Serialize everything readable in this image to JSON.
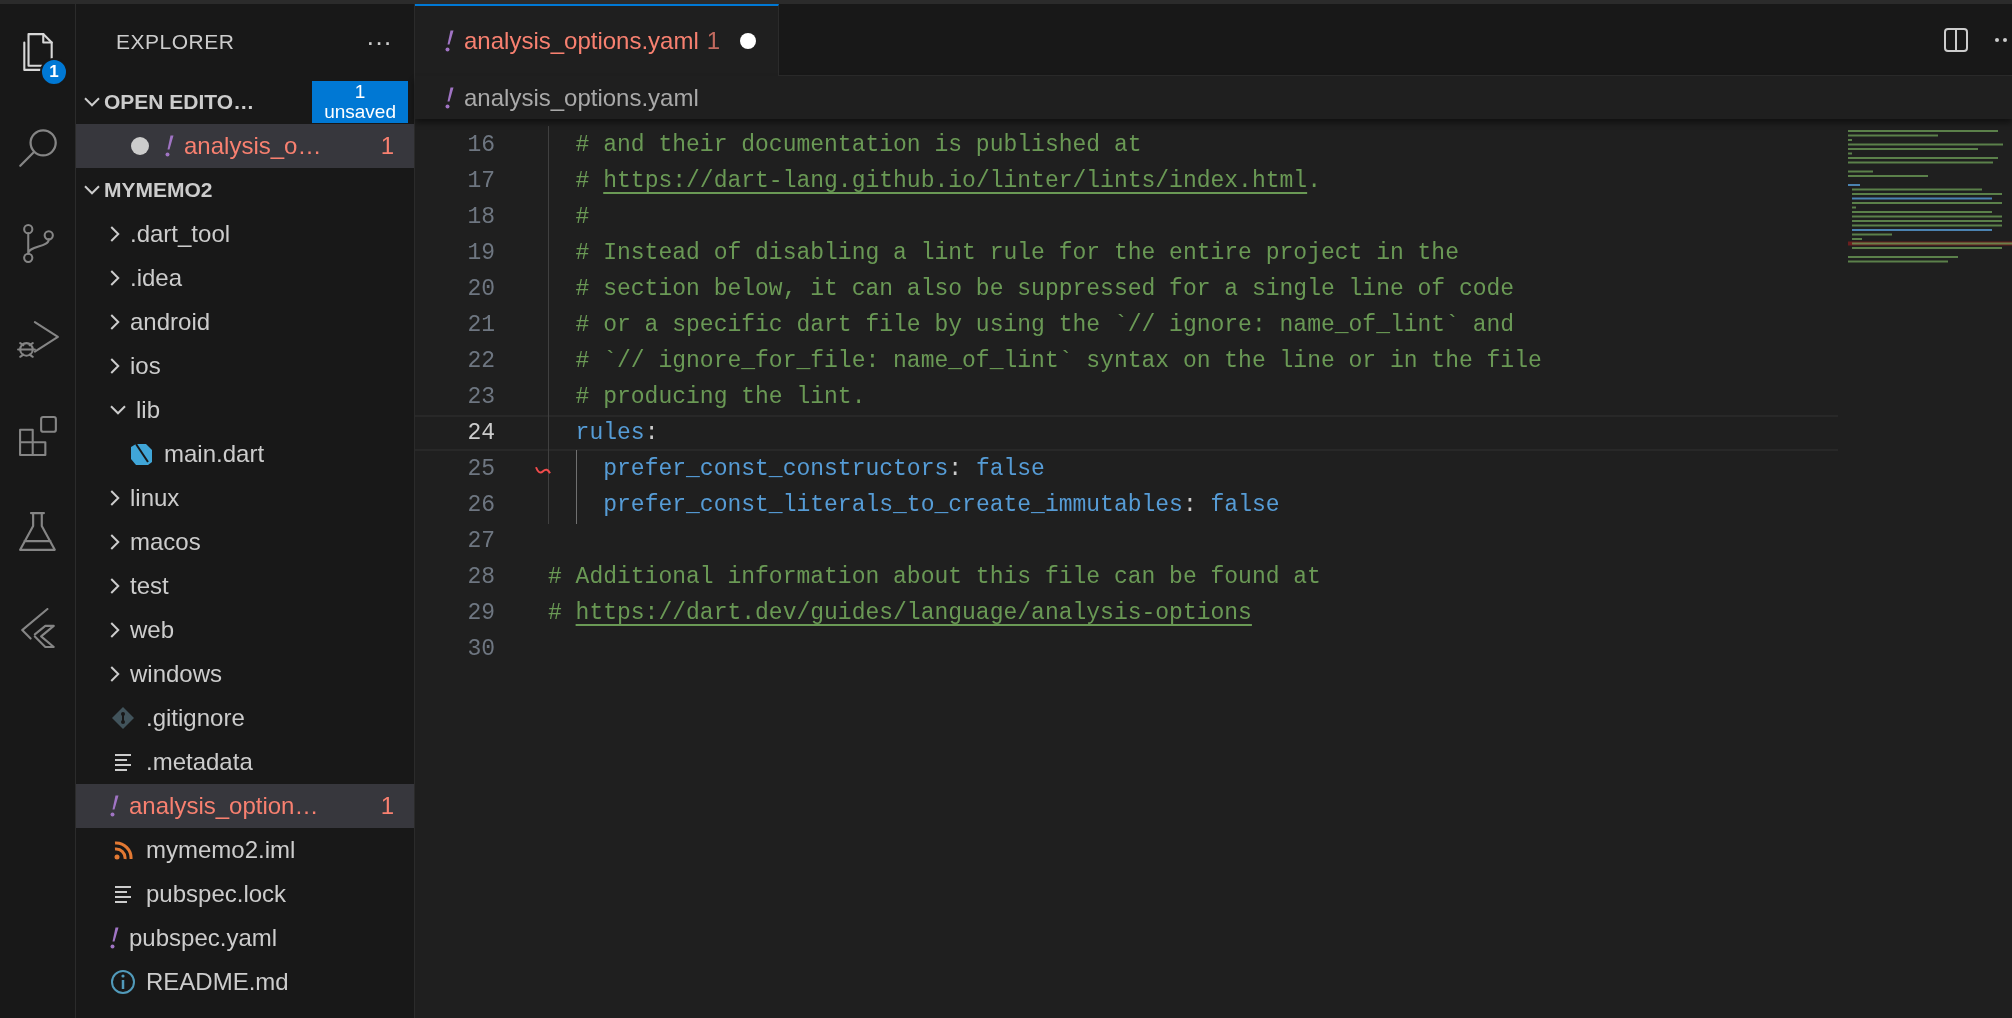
{
  "activity_bar": [
    {
      "kind": "files",
      "selected": true,
      "badge": "1"
    },
    {
      "kind": "search",
      "selected": false
    },
    {
      "kind": "source-control",
      "selected": false
    },
    {
      "kind": "run-debug",
      "selected": false
    },
    {
      "kind": "extensions",
      "selected": false
    },
    {
      "kind": "testing",
      "selected": false
    },
    {
      "kind": "flutter",
      "selected": false
    }
  ],
  "sidebar": {
    "title": "EXPLORER",
    "more": "···",
    "open_editors": {
      "label": "OPEN EDITO…",
      "expanded": true,
      "badge": "1 unsaved",
      "items": [
        {
          "name": "analysis_o…",
          "kind": "yaml",
          "problems": "1",
          "error": true,
          "dirty": true,
          "selected": true
        }
      ]
    },
    "project": {
      "label": "MYMEMO2",
      "expanded": true,
      "items": [
        {
          "name": ".dart_tool",
          "kind": "folder",
          "expanded": false,
          "error": false,
          "selected": false
        },
        {
          "name": ".idea",
          "kind": "folder",
          "expanded": false,
          "error": false,
          "selected": false
        },
        {
          "name": "android",
          "kind": "folder",
          "expanded": false,
          "error": false,
          "selected": false
        },
        {
          "name": "ios",
          "kind": "folder",
          "expanded": false,
          "error": false,
          "selected": false
        },
        {
          "name": "lib",
          "kind": "folder",
          "expanded": true,
          "error": false,
          "selected": false,
          "children": [
            {
              "name": "main.dart",
              "kind": "dart",
              "error": false,
              "selected": false
            }
          ]
        },
        {
          "name": "linux",
          "kind": "folder",
          "expanded": false,
          "error": false,
          "selected": false
        },
        {
          "name": "macos",
          "kind": "folder",
          "expanded": false,
          "error": false,
          "selected": false
        },
        {
          "name": "test",
          "kind": "folder",
          "expanded": false,
          "error": false,
          "selected": false
        },
        {
          "name": "web",
          "kind": "folder",
          "expanded": false,
          "error": false,
          "selected": false
        },
        {
          "name": "windows",
          "kind": "folder",
          "expanded": false,
          "error": false,
          "selected": false
        },
        {
          "name": ".gitignore",
          "kind": "git",
          "error": false,
          "selected": false
        },
        {
          "name": ".metadata",
          "kind": "text",
          "error": false,
          "selected": false
        },
        {
          "name": "analysis_option…",
          "kind": "yaml",
          "error": true,
          "problems": "1",
          "selected": true
        },
        {
          "name": "mymemo2.iml",
          "kind": "rss",
          "error": false,
          "selected": false
        },
        {
          "name": "pubspec.lock",
          "kind": "text",
          "error": false,
          "selected": false
        },
        {
          "name": "pubspec.yaml",
          "kind": "yaml",
          "error": false,
          "selected": false
        },
        {
          "name": "README.md",
          "kind": "info",
          "error": false,
          "selected": false
        }
      ]
    }
  },
  "tabs": [
    {
      "label": "analysis_options.yaml",
      "kind": "yaml",
      "problems": "1",
      "error": true,
      "dirty": true,
      "selected": true
    }
  ],
  "breadcrumb": {
    "kind": "yaml",
    "label": "analysis_options.yaml"
  },
  "editor": {
    "lines": [
      {
        "number": "16",
        "current": false,
        "error": false,
        "segments": [
          {
            "kind": "comment",
            "text": "  # and their documentation is published at"
          }
        ]
      },
      {
        "number": "17",
        "current": false,
        "error": false,
        "segments": [
          {
            "kind": "comment",
            "text": "  # "
          },
          {
            "kind": "link",
            "text": "https://dart-lang.github.io/linter/lints/index.html"
          },
          {
            "kind": "comment",
            "text": "."
          }
        ]
      },
      {
        "number": "18",
        "current": false,
        "error": false,
        "segments": [
          {
            "kind": "comment",
            "text": "  #"
          }
        ]
      },
      {
        "number": "19",
        "current": false,
        "error": false,
        "segments": [
          {
            "kind": "comment",
            "text": "  # Instead of disabling a lint rule for the entire project in the"
          }
        ]
      },
      {
        "number": "20",
        "current": false,
        "error": false,
        "segments": [
          {
            "kind": "comment",
            "text": "  # section below, it can also be suppressed for a single line of code"
          }
        ]
      },
      {
        "number": "21",
        "current": false,
        "error": false,
        "segments": [
          {
            "kind": "comment",
            "text": "  # or a specific dart file by using the `// ignore: name_of_lint` and"
          }
        ]
      },
      {
        "number": "22",
        "current": false,
        "error": false,
        "segments": [
          {
            "kind": "comment",
            "text": "  # `// ignore_for_file: name_of_lint` syntax on the line or in the file"
          }
        ]
      },
      {
        "number": "23",
        "current": false,
        "error": false,
        "segments": [
          {
            "kind": "comment",
            "text": "  # producing the lint."
          }
        ]
      },
      {
        "number": "24",
        "current": true,
        "error": false,
        "segments": [
          {
            "kind": "key",
            "text": "  rules"
          },
          {
            "kind": "punct",
            "text": ":"
          }
        ]
      },
      {
        "number": "25",
        "current": false,
        "error": true,
        "segments": [
          {
            "kind": "key",
            "text": "    prefer_const_constructors"
          },
          {
            "kind": "punct",
            "text": ": "
          },
          {
            "kind": "value",
            "text": "false"
          }
        ]
      },
      {
        "number": "26",
        "current": false,
        "error": false,
        "segments": [
          {
            "kind": "key",
            "text": "    prefer_const_literals_to_create_immutables"
          },
          {
            "kind": "punct",
            "text": ": "
          },
          {
            "kind": "value",
            "text": "false"
          }
        ]
      },
      {
        "number": "27",
        "current": false,
        "error": false
      },
      {
        "number": "28",
        "current": false,
        "error": false,
        "segments": [
          {
            "kind": "comment",
            "text": "# Additional information about this file can be found at"
          }
        ]
      },
      {
        "number": "29",
        "current": false,
        "error": false,
        "segments": [
          {
            "kind": "comment",
            "text": "# "
          },
          {
            "kind": "link",
            "text": "https://dart.dev/guides/language/analysis-options"
          }
        ]
      },
      {
        "number": "30",
        "current": false,
        "error": false
      }
    ]
  }
}
